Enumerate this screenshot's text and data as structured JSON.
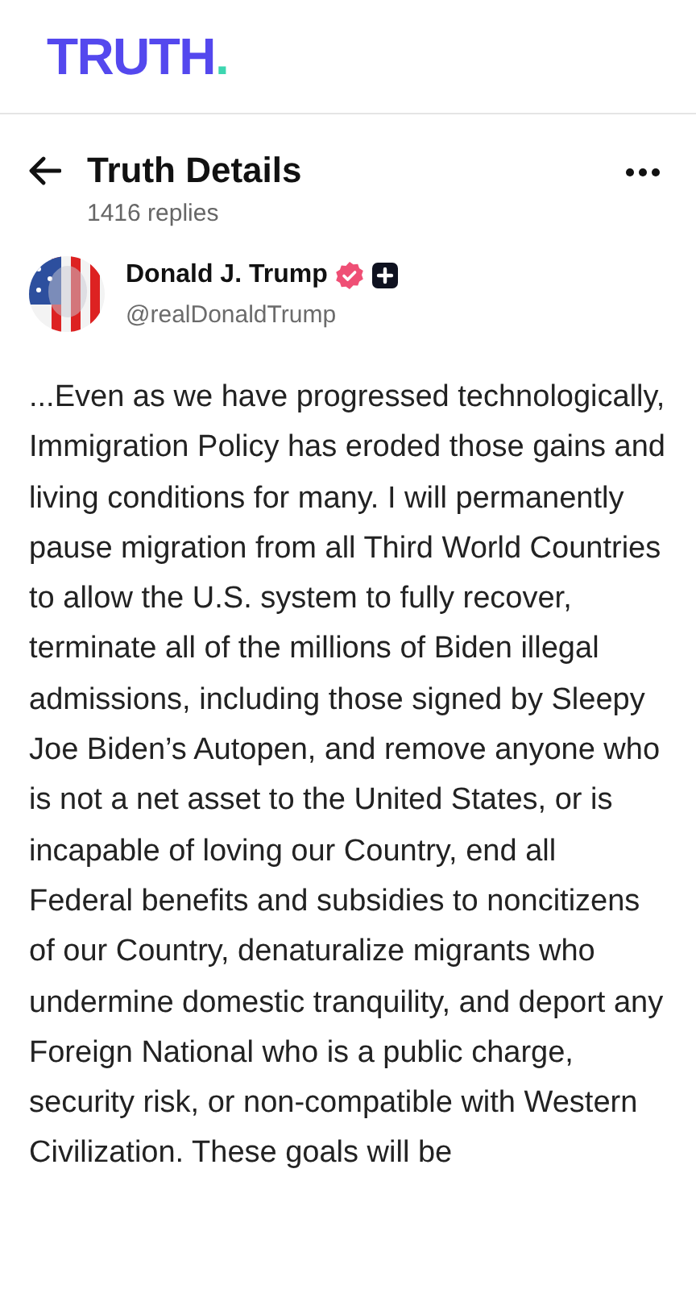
{
  "logo": {
    "text": "TRUTH",
    "dot": "."
  },
  "header": {
    "title": "Truth Details",
    "replies": "1416 replies"
  },
  "author": {
    "name": "Donald J. Trump",
    "handle": "@realDonaldTrump",
    "verified": true,
    "plus": true
  },
  "post": {
    "text": "...Even as we have progressed technologically, Immigration Policy has eroded those gains and living conditions for many. I will permanently pause migration from all Third World Countries to allow the U.S. system to fully recover, terminate all of the millions of Biden illegal admissions, including those signed by Sleepy Joe Biden’s Autopen, and remove anyone who is not a net asset to the United States, or is incapable of loving our Country, end all Federal benefits and subsidies to noncitizens of our Country, denaturalize migrants who undermine domestic tranquility, and deport any Foreign National who is a public charge, security risk, or non-compatible with Western Civilization. These goals will be"
  }
}
